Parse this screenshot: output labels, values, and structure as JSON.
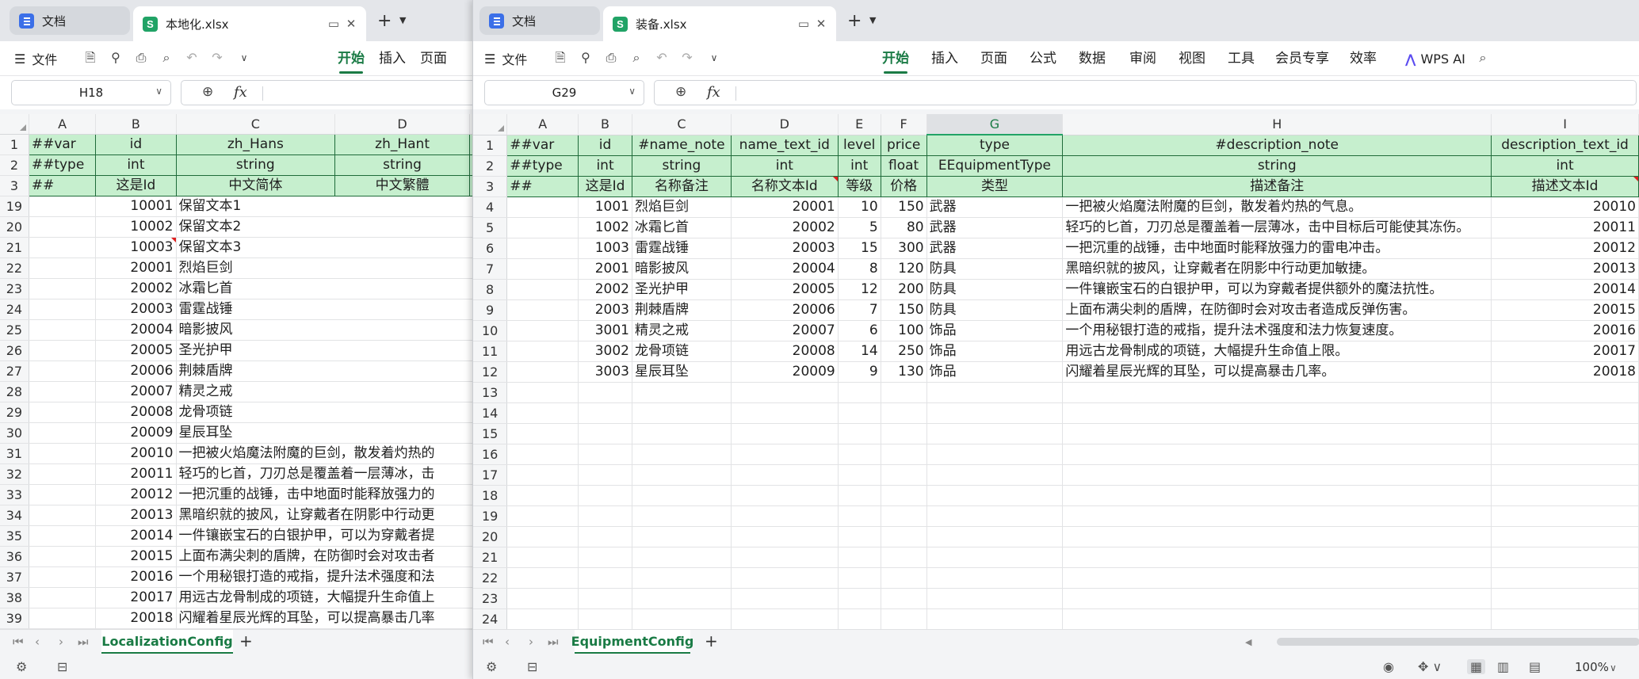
{
  "left": {
    "tabs": [
      {
        "title": "文档",
        "kind": "docs"
      },
      {
        "title": "本地化.xlsx",
        "kind": "sheet"
      }
    ],
    "toolbar": {
      "file": "文件",
      "menus": [
        "开始",
        "插入",
        "页面"
      ],
      "active_menu": "开始"
    },
    "name_box": "H18",
    "columns": [
      "A",
      "B",
      "C",
      "D"
    ],
    "header_rows": [
      {
        "row": "1",
        "cells": [
          "##var",
          "id",
          "zh_Hans",
          "zh_Hant"
        ]
      },
      {
        "row": "2",
        "cells": [
          "##type",
          "int",
          "string",
          "string"
        ]
      },
      {
        "row": "3",
        "cells": [
          "##",
          "这是Id",
          "中文简体",
          "中文繁體"
        ]
      }
    ],
    "data_rows": [
      {
        "row": "19",
        "id": "10001",
        "text": "保留文本1"
      },
      {
        "row": "20",
        "id": "10002",
        "text": "保留文本2"
      },
      {
        "row": "21",
        "id": "10003",
        "text": "保留文本3"
      },
      {
        "row": "22",
        "id": "20001",
        "text": "烈焰巨剑"
      },
      {
        "row": "23",
        "id": "20002",
        "text": "冰霜匕首"
      },
      {
        "row": "24",
        "id": "20003",
        "text": "雷霆战锤"
      },
      {
        "row": "25",
        "id": "20004",
        "text": "暗影披风"
      },
      {
        "row": "26",
        "id": "20005",
        "text": "圣光护甲"
      },
      {
        "row": "27",
        "id": "20006",
        "text": "荆棘盾牌"
      },
      {
        "row": "28",
        "id": "20007",
        "text": "精灵之戒"
      },
      {
        "row": "29",
        "id": "20008",
        "text": "龙骨项链"
      },
      {
        "row": "30",
        "id": "20009",
        "text": "星辰耳坠"
      },
      {
        "row": "31",
        "id": "20010",
        "text": "一把被火焰魔法附魔的巨剑，散发着灼热的"
      },
      {
        "row": "32",
        "id": "20011",
        "text": "轻巧的匕首，刀刃总是覆盖着一层薄冰，击"
      },
      {
        "row": "33",
        "id": "20012",
        "text": "一把沉重的战锤，击中地面时能释放强力的"
      },
      {
        "row": "34",
        "id": "20013",
        "text": "黑暗织就的披风，让穿戴者在阴影中行动更"
      },
      {
        "row": "35",
        "id": "20014",
        "text": "一件镶嵌宝石的白银护甲，可以为穿戴者提"
      },
      {
        "row": "36",
        "id": "20015",
        "text": "上面布满尖刺的盾牌，在防御时会对攻击者"
      },
      {
        "row": "37",
        "id": "20016",
        "text": "一个用秘银打造的戒指，提升法术强度和法"
      },
      {
        "row": "38",
        "id": "20017",
        "text": "用远古龙骨制成的项链，大幅提升生命值上"
      },
      {
        "row": "39",
        "id": "20018",
        "text": "闪耀着星辰光辉的耳坠，可以提高暴击几率"
      }
    ],
    "sheet_tab": "LocalizationConfig"
  },
  "right": {
    "tabs": [
      {
        "title": "文档",
        "kind": "docs"
      },
      {
        "title": "装备.xlsx",
        "kind": "sheet"
      }
    ],
    "toolbar": {
      "file": "文件",
      "menus": [
        "开始",
        "插入",
        "页面",
        "公式",
        "数据",
        "审阅",
        "视图",
        "工具",
        "会员专享",
        "效率"
      ],
      "active_menu": "开始",
      "ai": "WPS AI"
    },
    "name_box": "G29",
    "columns": [
      "A",
      "B",
      "C",
      "D",
      "E",
      "F",
      "G",
      "H",
      "I"
    ],
    "selected_column": "G",
    "header_rows": [
      {
        "row": "1",
        "cells": [
          "##var",
          "id",
          "#name_note",
          "name_text_id",
          "level",
          "price",
          "type",
          "#description_note",
          "description_text_id"
        ]
      },
      {
        "row": "2",
        "cells": [
          "##type",
          "int",
          "string",
          "int",
          "int",
          "float",
          "EEquipmentType",
          "string",
          "int"
        ]
      },
      {
        "row": "3",
        "cells": [
          "##",
          "这是Id",
          "名称备注",
          "名称文本Id",
          "等级",
          "价格",
          "类型",
          "描述备注",
          "描述文本Id"
        ]
      }
    ],
    "data_rows": [
      {
        "row": "4",
        "id": "1001",
        "name": "烈焰巨剑",
        "name_text_id": "20001",
        "level": "10",
        "price": "150",
        "type": "武器",
        "desc": "一把被火焰魔法附魔的巨剑，散发着灼热的气息。",
        "desc_id": "20010"
      },
      {
        "row": "5",
        "id": "1002",
        "name": "冰霜匕首",
        "name_text_id": "20002",
        "level": "5",
        "price": "80",
        "type": "武器",
        "desc": "轻巧的匕首，刀刃总是覆盖着一层薄冰，击中目标后可能使其冻伤。",
        "desc_id": "20011"
      },
      {
        "row": "6",
        "id": "1003",
        "name": "雷霆战锤",
        "name_text_id": "20003",
        "level": "15",
        "price": "300",
        "type": "武器",
        "desc": "一把沉重的战锤，击中地面时能释放强力的雷电冲击。",
        "desc_id": "20012"
      },
      {
        "row": "7",
        "id": "2001",
        "name": "暗影披风",
        "name_text_id": "20004",
        "level": "8",
        "price": "120",
        "type": "防具",
        "desc": "黑暗织就的披风，让穿戴者在阴影中行动更加敏捷。",
        "desc_id": "20013"
      },
      {
        "row": "8",
        "id": "2002",
        "name": "圣光护甲",
        "name_text_id": "20005",
        "level": "12",
        "price": "200",
        "type": "防具",
        "desc": "一件镶嵌宝石的白银护甲，可以为穿戴者提供额外的魔法抗性。",
        "desc_id": "20014"
      },
      {
        "row": "9",
        "id": "2003",
        "name": "荆棘盾牌",
        "name_text_id": "20006",
        "level": "7",
        "price": "150",
        "type": "防具",
        "desc": "上面布满尖刺的盾牌，在防御时会对攻击者造成反弹伤害。",
        "desc_id": "20015"
      },
      {
        "row": "10",
        "id": "3001",
        "name": "精灵之戒",
        "name_text_id": "20007",
        "level": "6",
        "price": "100",
        "type": "饰品",
        "desc": "一个用秘银打造的戒指，提升法术强度和法力恢复速度。",
        "desc_id": "20016"
      },
      {
        "row": "11",
        "id": "3002",
        "name": "龙骨项链",
        "name_text_id": "20008",
        "level": "14",
        "price": "250",
        "type": "饰品",
        "desc": "用远古龙骨制成的项链，大幅提升生命值上限。",
        "desc_id": "20017"
      },
      {
        "row": "12",
        "id": "3003",
        "name": "星辰耳坠",
        "name_text_id": "20009",
        "level": "9",
        "price": "130",
        "type": "饰品",
        "desc": "闪耀着星辰光辉的耳坠，可以提高暴击几率。",
        "desc_id": "20018"
      }
    ],
    "empty_rows": [
      "13",
      "14",
      "15",
      "16",
      "17",
      "18",
      "19",
      "20",
      "21",
      "22",
      "23",
      "24"
    ],
    "sheet_tab": "EquipmentConfig",
    "zoom": "100%"
  },
  "colors": {
    "header_fill": "#c6efce",
    "accent": "#1a7b45",
    "doc_icon": "#3b6fe8",
    "sheet_icon": "#21a366"
  },
  "icons": [
    "doc-icon",
    "sheet-s-icon",
    "close-icon",
    "restore-icon",
    "plus-icon",
    "menu-icon",
    "save-icon",
    "print-icon",
    "undo-icon",
    "redo-icon",
    "chevron-down-icon",
    "zoom-icon",
    "fx-icon",
    "ai-icon",
    "search-icon",
    "eye-icon",
    "grid-view-icon"
  ]
}
